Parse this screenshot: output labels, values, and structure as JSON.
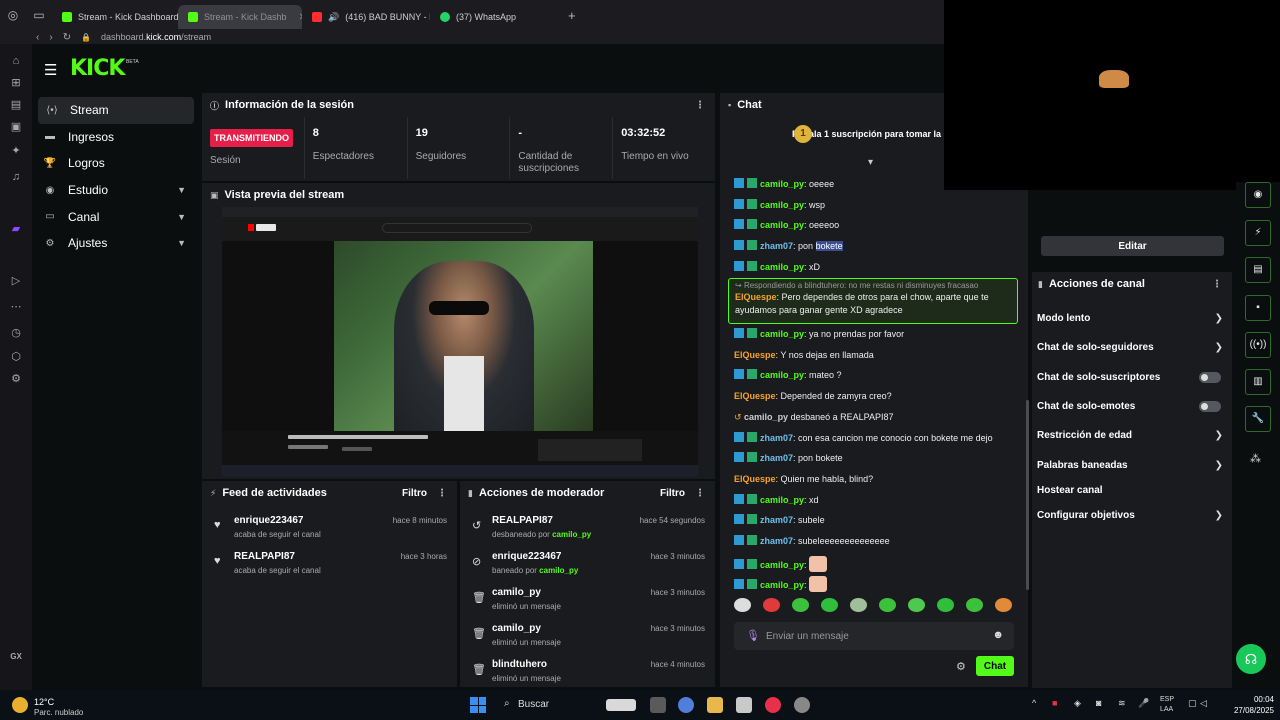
{
  "browser": {
    "tabs": [
      {
        "title": "Stream - Kick Dashboard",
        "color": "#53fc18"
      },
      {
        "title": "Stream - Kick Dashb",
        "color": "#53fc18"
      },
      {
        "title": "(416) BAD BUNNY - B",
        "color": "#ff2d2d"
      },
      {
        "title": "(37) WhatsApp",
        "color": "#25d366"
      }
    ],
    "url_prefix": "dashboard.",
    "url_domain": "kick.com",
    "url_path": "/stream",
    "sidebar_bottom_label": "GX"
  },
  "header": {
    "logo": "KICK",
    "logo_badge": "BETA"
  },
  "nav": {
    "items": [
      {
        "label": "Stream",
        "icon": "stream-icon"
      },
      {
        "label": "Ingresos",
        "icon": "money-icon"
      },
      {
        "label": "Logros",
        "icon": "trophy-icon"
      },
      {
        "label": "Estudio",
        "icon": "studio-icon"
      },
      {
        "label": "Canal",
        "icon": "channel-icon"
      },
      {
        "label": "Ajustes",
        "icon": "settings-icon"
      }
    ]
  },
  "session": {
    "title": "Información de la sesión",
    "status": "TRANSMITIENDO",
    "status_label": "Sesión",
    "viewers": "8",
    "viewers_label": "Espectadores",
    "followers": "19",
    "followers_label": "Seguidores",
    "subs": "-",
    "subs_label": "Cantidad de suscripciones",
    "uptime": "03:32:52",
    "uptime_label": "Tiempo en vivo"
  },
  "preview": {
    "title": "Vista previa del stream"
  },
  "feed": {
    "title": "Feed de actividades",
    "filter": "Filtro",
    "items": [
      {
        "name": "enrique223467",
        "text": "acaba de seguir el canal",
        "time": "hace 8 minutos"
      },
      {
        "name": "REALPAPI87",
        "text": "acaba de seguir el canal",
        "time": "hace 3 horas"
      }
    ]
  },
  "mods": {
    "title": "Acciones de moderador",
    "filter": "Filtro",
    "items": [
      {
        "name": "REALPAPI87",
        "action": "desbaneado por",
        "by": "camilo_py",
        "time": "hace 54 segundos",
        "icon": "unban-icon"
      },
      {
        "name": "enrique223467",
        "action": "baneado por",
        "by": "camilo_py",
        "time": "hace 3 minutos",
        "icon": "ban-icon"
      },
      {
        "name": "camilo_py",
        "action": "eliminó un mensaje",
        "by": "",
        "time": "hace 3 minutos",
        "icon": "trash-icon"
      },
      {
        "name": "camilo_py",
        "action": "eliminó un mensaje",
        "by": "",
        "time": "hace 3 minutos",
        "icon": "trash-icon"
      },
      {
        "name": "blindtuhero",
        "action": "eliminó un mensaje",
        "by": "",
        "time": "hace 4 minutos",
        "icon": "trash-icon"
      }
    ]
  },
  "chat": {
    "title": "Chat",
    "pinned": "Regala 1 suscripción para tomar la p",
    "messages": [
      {
        "user": "camilo_py",
        "text": "oeeee",
        "color": "#53fc18",
        "badges": true
      },
      {
        "user": "camilo_py",
        "text": "wsp",
        "color": "#53fc18",
        "badges": true
      },
      {
        "user": "camilo_py",
        "text": "oeeeoo",
        "color": "#53fc18",
        "badges": true
      },
      {
        "user": "zham07",
        "text": "pon ",
        "highlight": "bokete",
        "color": "#6fc1ea",
        "badges": true
      },
      {
        "user": "camilo_py",
        "text": "xD",
        "color": "#53fc18",
        "badges": true
      }
    ],
    "reply": {
      "context": "Respondiendo a blindtuhero: no me restas ni disminuyes fracasao",
      "user": "ElQuespe",
      "text": "Pero dependes de otros para el chow, aparte que te ayudamos para ganar gente XD agradece"
    },
    "messages2": [
      {
        "user": "camilo_py",
        "text": "ya no prendas por favor",
        "color": "#53fc18",
        "badges": true
      },
      {
        "user": "ElQuespe",
        "text": "Y nos dejas en llamada",
        "color": "#f6a32b",
        "badges": false
      },
      {
        "user": "camilo_py",
        "text": "mateo ?",
        "color": "#53fc18",
        "badges": true
      },
      {
        "user": "ElQuespe",
        "text": "Depended de zamyra creo?",
        "color": "#f6a32b",
        "badges": false
      },
      {
        "user": "camilo_py",
        "text": "desbaneó a REALPAPI87",
        "color": "#cccccc",
        "badges": false,
        "system": true
      },
      {
        "user": "zham07",
        "text": "con esa cancion me conocio con bokete me dejo",
        "color": "#6fc1ea",
        "badges": true
      },
      {
        "user": "zham07",
        "text": "pon bokete",
        "color": "#6fc1ea",
        "badges": true
      },
      {
        "user": "ElQuespe",
        "text": "Quien me habla, blind?",
        "color": "#f6a32b",
        "badges": false
      },
      {
        "user": "camilo_py",
        "text": "xd",
        "color": "#53fc18",
        "badges": true
      },
      {
        "user": "zham07",
        "text": "subele",
        "color": "#6fc1ea",
        "badges": true
      },
      {
        "user": "zham07",
        "text": "subeleeeeeeeeeeeeee",
        "color": "#6fc1ea",
        "badges": true
      },
      {
        "user": "camilo_py",
        "text": "",
        "color": "#53fc18",
        "badges": true,
        "emote": true
      },
      {
        "user": "camilo_py",
        "text": "",
        "color": "#53fc18",
        "badges": true,
        "emote": true
      }
    ],
    "input_placeholder": "Enviar un mensaje",
    "send": "Chat"
  },
  "right": {
    "edit": "Editar",
    "actions_title": "Acciones de canal",
    "actions": [
      {
        "label": "Modo lento",
        "kind": "arrow"
      },
      {
        "label": "Chat de solo-seguidores",
        "kind": "arrow"
      },
      {
        "label": "Chat de solo-suscriptores",
        "kind": "toggle"
      },
      {
        "label": "Chat de solo-emotes",
        "kind": "toggle"
      },
      {
        "label": "Restricción de edad",
        "kind": "arrow"
      },
      {
        "label": "Palabras baneadas",
        "kind": "arrow"
      },
      {
        "label": "Hostear canal",
        "kind": "none"
      },
      {
        "label": "Configurar objetivos",
        "kind": "arrow"
      }
    ]
  },
  "taskbar": {
    "temp": "12°C",
    "weather": "Parc. nublado",
    "search": "Buscar",
    "lang1": "ESP",
    "lang2": "LAA",
    "time": "00:04",
    "date": "27/08/2025"
  }
}
